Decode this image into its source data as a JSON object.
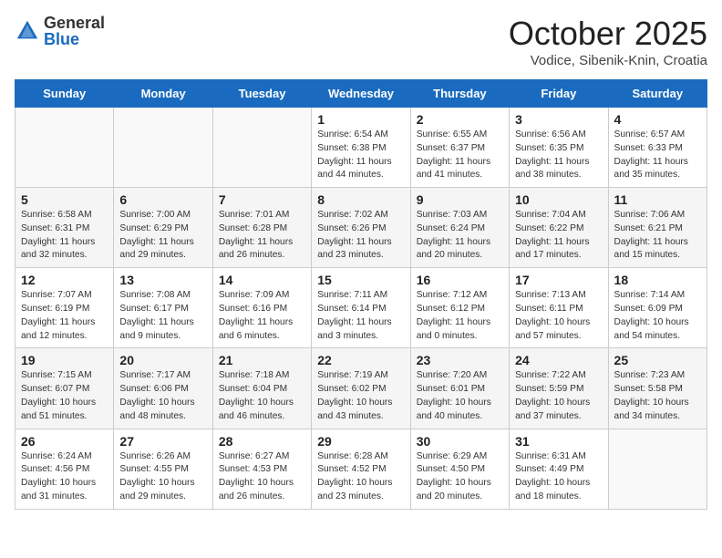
{
  "header": {
    "logo_general": "General",
    "logo_blue": "Blue",
    "month": "October 2025",
    "location": "Vodice, Sibenik-Knin, Croatia"
  },
  "weekdays": [
    "Sunday",
    "Monday",
    "Tuesday",
    "Wednesday",
    "Thursday",
    "Friday",
    "Saturday"
  ],
  "weeks": [
    [
      {
        "date": "",
        "info": ""
      },
      {
        "date": "",
        "info": ""
      },
      {
        "date": "",
        "info": ""
      },
      {
        "date": "1",
        "info": "Sunrise: 6:54 AM\nSunset: 6:38 PM\nDaylight: 11 hours\nand 44 minutes."
      },
      {
        "date": "2",
        "info": "Sunrise: 6:55 AM\nSunset: 6:37 PM\nDaylight: 11 hours\nand 41 minutes."
      },
      {
        "date": "3",
        "info": "Sunrise: 6:56 AM\nSunset: 6:35 PM\nDaylight: 11 hours\nand 38 minutes."
      },
      {
        "date": "4",
        "info": "Sunrise: 6:57 AM\nSunset: 6:33 PM\nDaylight: 11 hours\nand 35 minutes."
      }
    ],
    [
      {
        "date": "5",
        "info": "Sunrise: 6:58 AM\nSunset: 6:31 PM\nDaylight: 11 hours\nand 32 minutes."
      },
      {
        "date": "6",
        "info": "Sunrise: 7:00 AM\nSunset: 6:29 PM\nDaylight: 11 hours\nand 29 minutes."
      },
      {
        "date": "7",
        "info": "Sunrise: 7:01 AM\nSunset: 6:28 PM\nDaylight: 11 hours\nand 26 minutes."
      },
      {
        "date": "8",
        "info": "Sunrise: 7:02 AM\nSunset: 6:26 PM\nDaylight: 11 hours\nand 23 minutes."
      },
      {
        "date": "9",
        "info": "Sunrise: 7:03 AM\nSunset: 6:24 PM\nDaylight: 11 hours\nand 20 minutes."
      },
      {
        "date": "10",
        "info": "Sunrise: 7:04 AM\nSunset: 6:22 PM\nDaylight: 11 hours\nand 17 minutes."
      },
      {
        "date": "11",
        "info": "Sunrise: 7:06 AM\nSunset: 6:21 PM\nDaylight: 11 hours\nand 15 minutes."
      }
    ],
    [
      {
        "date": "12",
        "info": "Sunrise: 7:07 AM\nSunset: 6:19 PM\nDaylight: 11 hours\nand 12 minutes."
      },
      {
        "date": "13",
        "info": "Sunrise: 7:08 AM\nSunset: 6:17 PM\nDaylight: 11 hours\nand 9 minutes."
      },
      {
        "date": "14",
        "info": "Sunrise: 7:09 AM\nSunset: 6:16 PM\nDaylight: 11 hours\nand 6 minutes."
      },
      {
        "date": "15",
        "info": "Sunrise: 7:11 AM\nSunset: 6:14 PM\nDaylight: 11 hours\nand 3 minutes."
      },
      {
        "date": "16",
        "info": "Sunrise: 7:12 AM\nSunset: 6:12 PM\nDaylight: 11 hours\nand 0 minutes."
      },
      {
        "date": "17",
        "info": "Sunrise: 7:13 AM\nSunset: 6:11 PM\nDaylight: 10 hours\nand 57 minutes."
      },
      {
        "date": "18",
        "info": "Sunrise: 7:14 AM\nSunset: 6:09 PM\nDaylight: 10 hours\nand 54 minutes."
      }
    ],
    [
      {
        "date": "19",
        "info": "Sunrise: 7:15 AM\nSunset: 6:07 PM\nDaylight: 10 hours\nand 51 minutes."
      },
      {
        "date": "20",
        "info": "Sunrise: 7:17 AM\nSunset: 6:06 PM\nDaylight: 10 hours\nand 48 minutes."
      },
      {
        "date": "21",
        "info": "Sunrise: 7:18 AM\nSunset: 6:04 PM\nDaylight: 10 hours\nand 46 minutes."
      },
      {
        "date": "22",
        "info": "Sunrise: 7:19 AM\nSunset: 6:02 PM\nDaylight: 10 hours\nand 43 minutes."
      },
      {
        "date": "23",
        "info": "Sunrise: 7:20 AM\nSunset: 6:01 PM\nDaylight: 10 hours\nand 40 minutes."
      },
      {
        "date": "24",
        "info": "Sunrise: 7:22 AM\nSunset: 5:59 PM\nDaylight: 10 hours\nand 37 minutes."
      },
      {
        "date": "25",
        "info": "Sunrise: 7:23 AM\nSunset: 5:58 PM\nDaylight: 10 hours\nand 34 minutes."
      }
    ],
    [
      {
        "date": "26",
        "info": "Sunrise: 6:24 AM\nSunset: 4:56 PM\nDaylight: 10 hours\nand 31 minutes."
      },
      {
        "date": "27",
        "info": "Sunrise: 6:26 AM\nSunset: 4:55 PM\nDaylight: 10 hours\nand 29 minutes."
      },
      {
        "date": "28",
        "info": "Sunrise: 6:27 AM\nSunset: 4:53 PM\nDaylight: 10 hours\nand 26 minutes."
      },
      {
        "date": "29",
        "info": "Sunrise: 6:28 AM\nSunset: 4:52 PM\nDaylight: 10 hours\nand 23 minutes."
      },
      {
        "date": "30",
        "info": "Sunrise: 6:29 AM\nSunset: 4:50 PM\nDaylight: 10 hours\nand 20 minutes."
      },
      {
        "date": "31",
        "info": "Sunrise: 6:31 AM\nSunset: 4:49 PM\nDaylight: 10 hours\nand 18 minutes."
      },
      {
        "date": "",
        "info": ""
      }
    ]
  ]
}
